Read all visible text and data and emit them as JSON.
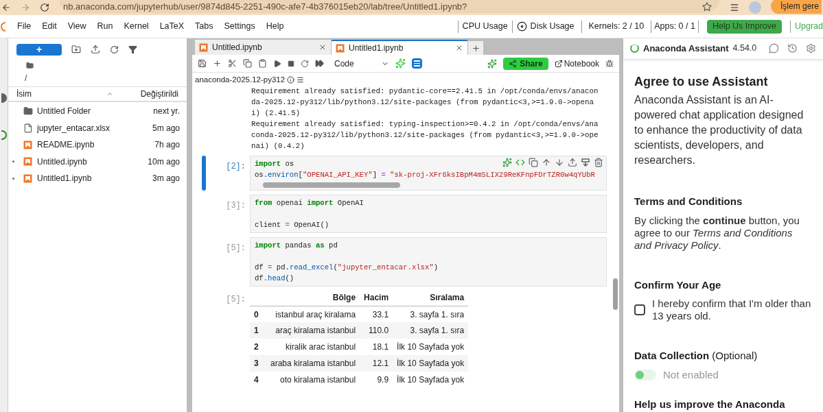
{
  "browser": {
    "url": "nb.anaconda.com/jupyterhub/user/9874d845-2251-490c-afe7-4b376015eb20/lab/tree/Untitled1.ipynb?",
    "action": "İşlem gere"
  },
  "menu": [
    "File",
    "Edit",
    "View",
    "Run",
    "Kernel",
    "LaTeX",
    "Tabs",
    "Settings",
    "Help"
  ],
  "status": {
    "cpu": "CPU Usage",
    "disk": "Disk Usage",
    "kernels": "Kernels: 2 / 10",
    "apps": "Apps: 0 / 1",
    "help": "Help Us Improve",
    "upgrade": "Upgrad"
  },
  "file_browser": {
    "new_button": "+",
    "path": "/",
    "columns": [
      "İsim",
      "Değiştirildi"
    ],
    "files": [
      {
        "kind": "folder",
        "name": "Untitled Folder",
        "modified": "next yr.",
        "running": false
      },
      {
        "kind": "file",
        "name": "jupyter_entacar.xlsx",
        "modified": "5m ago",
        "running": false
      },
      {
        "kind": "notebook",
        "name": "README.ipynb",
        "modified": "7h ago",
        "running": false
      },
      {
        "kind": "notebook",
        "name": "Untitled.ipynb",
        "modified": "10m ago",
        "running": true
      },
      {
        "kind": "notebook",
        "name": "Untitled1.ipynb",
        "modified": "3m ago",
        "running": true
      }
    ]
  },
  "tabs": [
    {
      "label": "Untitled.ipynb",
      "selected": false
    },
    {
      "label": "Untitled1.ipynb",
      "selected": true
    }
  ],
  "toolbar": {
    "cell_type": "Code",
    "share": "Share",
    "notebook": "Notebook"
  },
  "kernel_label": "anaconda-2025.12-py312",
  "output_lines": [
    "Requirement already satisfied: pydantic-core==2.41.5 in /opt/conda/envs/anacon",
    "da-2025.12-py312/lib/python3.12/site-packages (from pydantic<3,>=1.9.0->opena",
    "i) (2.41.5)",
    "Requirement already satisfied: typing-inspection>=0.4.2 in /opt/conda/envs/ana",
    "conda-2025.12-py312/lib/python3.12/site-packages (from pydantic<3,>=1.9.0->ope",
    "nai) (0.4.2)"
  ],
  "cells": [
    {
      "prompt": "[2]:",
      "active": true,
      "scrollbar": true,
      "lines": [
        {
          "kind": "code",
          "tokens": [
            {
              "kind": "kw",
              "text": "import"
            },
            {
              "kind": "plain",
              "text": " os"
            }
          ]
        },
        {
          "kind": "code",
          "tokens": [
            {
              "kind": "plain",
              "text": "os."
            },
            {
              "kind": "fn",
              "text": "environ"
            },
            {
              "kind": "plain",
              "text": "["
            },
            {
              "kind": "str",
              "text": "\"OPENAI_API_KEY\""
            },
            {
              "kind": "plain",
              "text": "] "
            },
            {
              "kind": "op",
              "text": "="
            },
            {
              "kind": "str",
              "text": " \"sk-proj-XFr6ksIBpM4mSLIX29ReKFnpFDrTZR0w4qYUbR"
            }
          ]
        }
      ]
    },
    {
      "prompt": "[3]:",
      "active": false,
      "scrollbar": false,
      "lines": [
        {
          "kind": "code",
          "tokens": [
            {
              "kind": "kw",
              "text": "from"
            },
            {
              "kind": "plain",
              "text": " openai "
            },
            {
              "kind": "kw",
              "text": "import"
            },
            {
              "kind": "plain",
              "text": " OpenAI"
            }
          ]
        },
        {
          "kind": "blank"
        },
        {
          "kind": "code",
          "tokens": [
            {
              "kind": "plain",
              "text": "client "
            },
            {
              "kind": "op",
              "text": "="
            },
            {
              "kind": "plain",
              "text": " OpenAI()"
            }
          ]
        }
      ]
    },
    {
      "prompt": "[5]:",
      "active": false,
      "scrollbar": false,
      "lines": [
        {
          "kind": "code",
          "tokens": [
            {
              "kind": "kw",
              "text": "import"
            },
            {
              "kind": "plain",
              "text": " pandas "
            },
            {
              "kind": "kw",
              "text": "as"
            },
            {
              "kind": "plain",
              "text": " pd"
            }
          ]
        },
        {
          "kind": "blank"
        },
        {
          "kind": "code",
          "tokens": [
            {
              "kind": "plain",
              "text": "df "
            },
            {
              "kind": "op",
              "text": "="
            },
            {
              "kind": "plain",
              "text": " pd."
            },
            {
              "kind": "fn",
              "text": "read_excel"
            },
            {
              "kind": "plain",
              "text": "("
            },
            {
              "kind": "str",
              "text": "\"jupyter_entacar.xlsx\""
            },
            {
              "kind": "plain",
              "text": ")"
            }
          ]
        },
        {
          "kind": "code",
          "tokens": [
            {
              "kind": "plain",
              "text": "df."
            },
            {
              "kind": "fn",
              "text": "head"
            },
            {
              "kind": "plain",
              "text": "()"
            }
          ]
        }
      ]
    }
  ],
  "result": {
    "prompt": "[5]:",
    "columns": [
      "Bölge",
      "Hacim",
      "Sıralama"
    ],
    "rows": [
      {
        "index": "0",
        "cells": [
          "istanbul araç kiralama",
          "33.1",
          "3. sayfa 1. sıra"
        ]
      },
      {
        "index": "1",
        "cells": [
          "araç kiralama istanbul",
          "110.0",
          "3. sayfa 1. sıra"
        ]
      },
      {
        "index": "2",
        "cells": [
          "kiralik arac istanbul",
          "18.1",
          "İlk 10 Sayfada yok"
        ]
      },
      {
        "index": "3",
        "cells": [
          "araba kiralama istanbul",
          "12.1",
          "İlk 10 Sayfada yok"
        ]
      },
      {
        "index": "4",
        "cells": [
          "oto kiralama istanbul",
          "9.9",
          "İlk 10 Sayfada yok"
        ]
      }
    ]
  },
  "assistant": {
    "title": "Anaconda Assistant",
    "version": "4.54.0",
    "heading": "Agree to use Assistant",
    "intro": "Anaconda Assistant is an AI-powered chat application designed to enhance the productivity of data scientists, developers, and researchers.",
    "terms_heading": "Terms and Conditions",
    "terms_text": "By clicking the **continue** button, you agree to our *Terms and Conditions and Privacy Policy*.",
    "age_heading": "Confirm Your Age",
    "age_label": "I hereby confirm that I'm older than 13 years old.",
    "age_checked": false,
    "data_heading": "Data Collection",
    "data_optional": "(Optional)",
    "data_toggle": {
      "on": false,
      "label": "Not enabled"
    },
    "help_heading": "Help us improve the Anaconda"
  }
}
